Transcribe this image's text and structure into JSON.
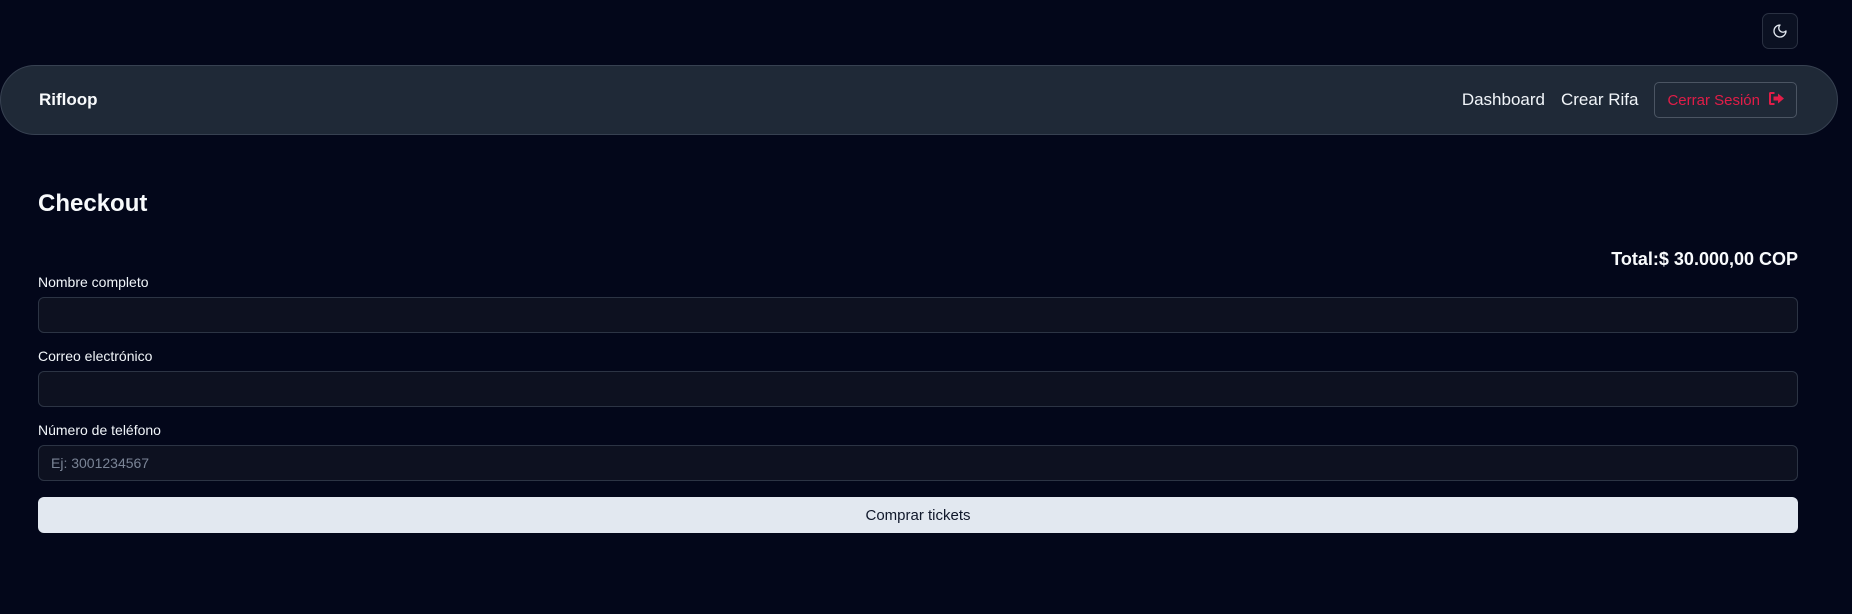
{
  "theme_toggle": {
    "icon": "moon-icon"
  },
  "navbar": {
    "brand": "Rifloop",
    "links": [
      "Dashboard",
      "Crear Rifa"
    ],
    "logout": {
      "label": "Cerrar Sesión",
      "icon": "sign-out-icon",
      "color": "#e11d48"
    }
  },
  "checkout": {
    "title": "Checkout",
    "total": "Total:$ 30.000,00 COP",
    "fields": {
      "name": {
        "label": "Nombre completo",
        "value": "",
        "placeholder": ""
      },
      "email": {
        "label": "Correo electrónico",
        "value": "",
        "placeholder": ""
      },
      "phone": {
        "label": "Número de teléfono",
        "value": "",
        "placeholder": "Ej: 3001234567"
      }
    },
    "submit_label": "Comprar tickets"
  },
  "colors": {
    "background": "#03071a",
    "navbar": "#1f2937",
    "accent_danger": "#e11d48",
    "button": "#e2e8f0"
  }
}
